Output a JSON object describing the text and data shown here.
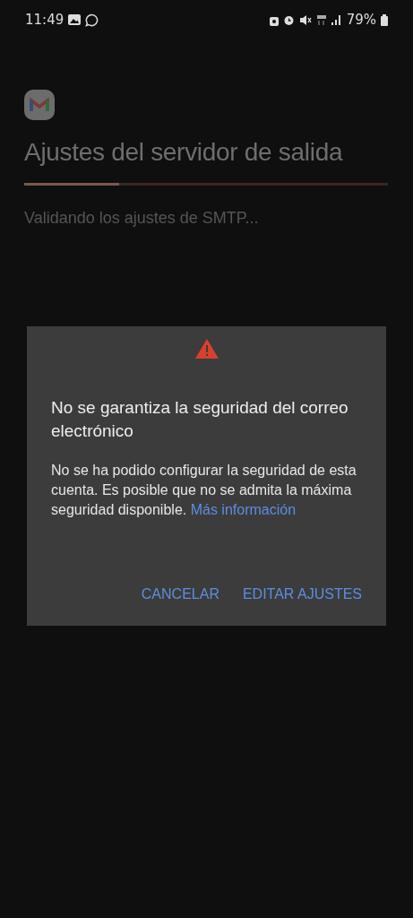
{
  "status_bar": {
    "time": "11:49",
    "battery": "79%"
  },
  "header": {
    "title": "Ajustes del servidor de salida",
    "progress": {
      "level": 0.26
    },
    "message": "Validando los ajustes de SMTP..."
  },
  "dialog": {
    "title": "No se garantiza la seguridad del correo electrónico",
    "body": "No se ha podido configurar la seguridad de esta cuenta. Es posible que no se admita la máxima seguridad disponible.",
    "link": "Más información",
    "buttons": [
      {
        "label": "CANCELAR"
      },
      {
        "label": "EDITAR AJUSTES"
      }
    ]
  }
}
